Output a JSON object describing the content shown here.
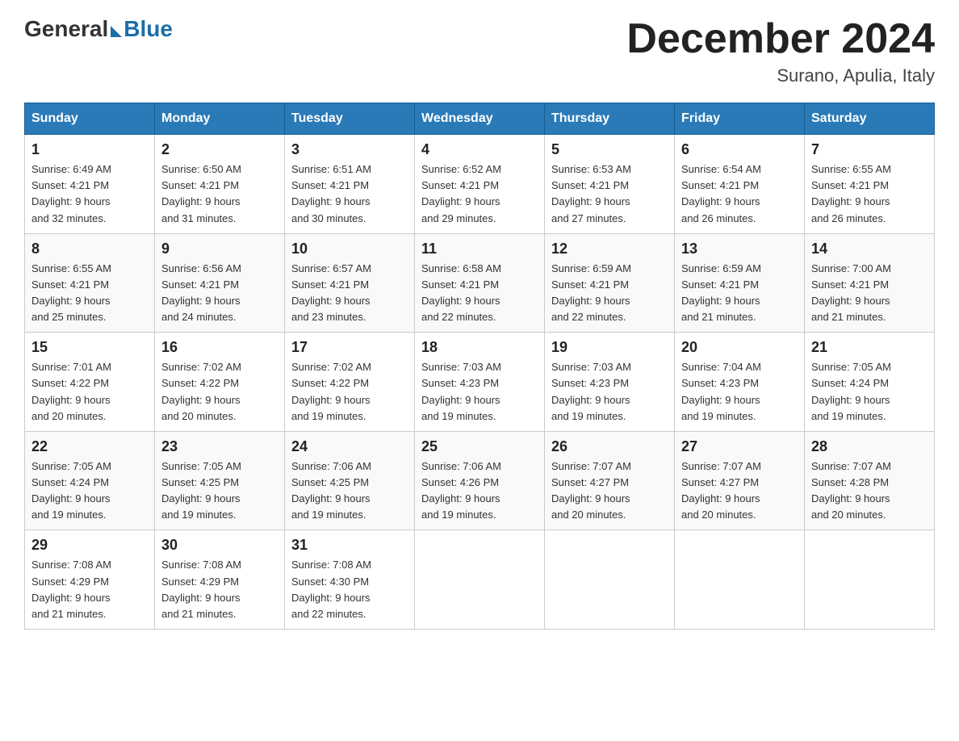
{
  "logo": {
    "general": "General",
    "blue": "Blue"
  },
  "title": "December 2024",
  "subtitle": "Surano, Apulia, Italy",
  "days_of_week": [
    "Sunday",
    "Monday",
    "Tuesday",
    "Wednesday",
    "Thursday",
    "Friday",
    "Saturday"
  ],
  "weeks": [
    [
      {
        "num": "1",
        "sunrise": "6:49 AM",
        "sunset": "4:21 PM",
        "daylight": "9 hours and 32 minutes."
      },
      {
        "num": "2",
        "sunrise": "6:50 AM",
        "sunset": "4:21 PM",
        "daylight": "9 hours and 31 minutes."
      },
      {
        "num": "3",
        "sunrise": "6:51 AM",
        "sunset": "4:21 PM",
        "daylight": "9 hours and 30 minutes."
      },
      {
        "num": "4",
        "sunrise": "6:52 AM",
        "sunset": "4:21 PM",
        "daylight": "9 hours and 29 minutes."
      },
      {
        "num": "5",
        "sunrise": "6:53 AM",
        "sunset": "4:21 PM",
        "daylight": "9 hours and 27 minutes."
      },
      {
        "num": "6",
        "sunrise": "6:54 AM",
        "sunset": "4:21 PM",
        "daylight": "9 hours and 26 minutes."
      },
      {
        "num": "7",
        "sunrise": "6:55 AM",
        "sunset": "4:21 PM",
        "daylight": "9 hours and 26 minutes."
      }
    ],
    [
      {
        "num": "8",
        "sunrise": "6:55 AM",
        "sunset": "4:21 PM",
        "daylight": "9 hours and 25 minutes."
      },
      {
        "num": "9",
        "sunrise": "6:56 AM",
        "sunset": "4:21 PM",
        "daylight": "9 hours and 24 minutes."
      },
      {
        "num": "10",
        "sunrise": "6:57 AM",
        "sunset": "4:21 PM",
        "daylight": "9 hours and 23 minutes."
      },
      {
        "num": "11",
        "sunrise": "6:58 AM",
        "sunset": "4:21 PM",
        "daylight": "9 hours and 22 minutes."
      },
      {
        "num": "12",
        "sunrise": "6:59 AM",
        "sunset": "4:21 PM",
        "daylight": "9 hours and 22 minutes."
      },
      {
        "num": "13",
        "sunrise": "6:59 AM",
        "sunset": "4:21 PM",
        "daylight": "9 hours and 21 minutes."
      },
      {
        "num": "14",
        "sunrise": "7:00 AM",
        "sunset": "4:21 PM",
        "daylight": "9 hours and 21 minutes."
      }
    ],
    [
      {
        "num": "15",
        "sunrise": "7:01 AM",
        "sunset": "4:22 PM",
        "daylight": "9 hours and 20 minutes."
      },
      {
        "num": "16",
        "sunrise": "7:02 AM",
        "sunset": "4:22 PM",
        "daylight": "9 hours and 20 minutes."
      },
      {
        "num": "17",
        "sunrise": "7:02 AM",
        "sunset": "4:22 PM",
        "daylight": "9 hours and 19 minutes."
      },
      {
        "num": "18",
        "sunrise": "7:03 AM",
        "sunset": "4:23 PM",
        "daylight": "9 hours and 19 minutes."
      },
      {
        "num": "19",
        "sunrise": "7:03 AM",
        "sunset": "4:23 PM",
        "daylight": "9 hours and 19 minutes."
      },
      {
        "num": "20",
        "sunrise": "7:04 AM",
        "sunset": "4:23 PM",
        "daylight": "9 hours and 19 minutes."
      },
      {
        "num": "21",
        "sunrise": "7:05 AM",
        "sunset": "4:24 PM",
        "daylight": "9 hours and 19 minutes."
      }
    ],
    [
      {
        "num": "22",
        "sunrise": "7:05 AM",
        "sunset": "4:24 PM",
        "daylight": "9 hours and 19 minutes."
      },
      {
        "num": "23",
        "sunrise": "7:05 AM",
        "sunset": "4:25 PM",
        "daylight": "9 hours and 19 minutes."
      },
      {
        "num": "24",
        "sunrise": "7:06 AM",
        "sunset": "4:25 PM",
        "daylight": "9 hours and 19 minutes."
      },
      {
        "num": "25",
        "sunrise": "7:06 AM",
        "sunset": "4:26 PM",
        "daylight": "9 hours and 19 minutes."
      },
      {
        "num": "26",
        "sunrise": "7:07 AM",
        "sunset": "4:27 PM",
        "daylight": "9 hours and 20 minutes."
      },
      {
        "num": "27",
        "sunrise": "7:07 AM",
        "sunset": "4:27 PM",
        "daylight": "9 hours and 20 minutes."
      },
      {
        "num": "28",
        "sunrise": "7:07 AM",
        "sunset": "4:28 PM",
        "daylight": "9 hours and 20 minutes."
      }
    ],
    [
      {
        "num": "29",
        "sunrise": "7:08 AM",
        "sunset": "4:29 PM",
        "daylight": "9 hours and 21 minutes."
      },
      {
        "num": "30",
        "sunrise": "7:08 AM",
        "sunset": "4:29 PM",
        "daylight": "9 hours and 21 minutes."
      },
      {
        "num": "31",
        "sunrise": "7:08 AM",
        "sunset": "4:30 PM",
        "daylight": "9 hours and 22 minutes."
      },
      null,
      null,
      null,
      null
    ]
  ],
  "labels": {
    "sunrise": "Sunrise:",
    "sunset": "Sunset:",
    "daylight": "Daylight:"
  }
}
